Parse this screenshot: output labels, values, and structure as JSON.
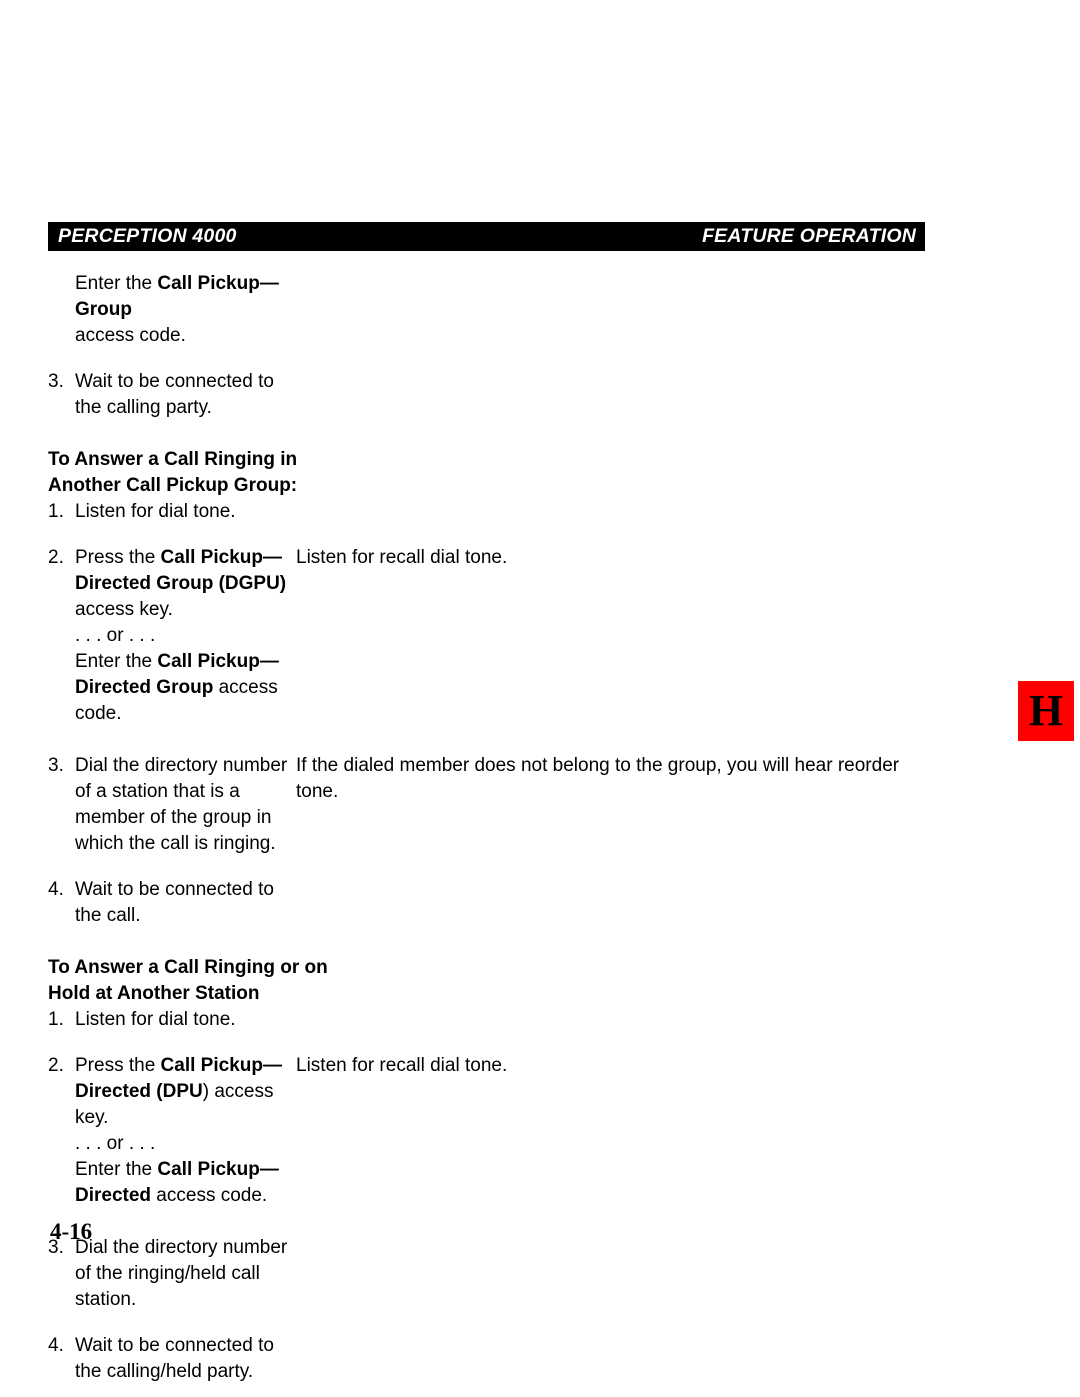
{
  "header": {
    "left_title": "PERCEPTION 4000",
    "right_title": "FEATURE OPERATION"
  },
  "thumb_tab": {
    "letter": "H",
    "background_color": "#fe0000",
    "text_color": "#000000"
  },
  "folio": {
    "page_number": "4-16"
  },
  "body": {
    "continuation": {
      "line1_prefix": "Enter the ",
      "line1_bold": "Call Pickup—Group",
      "line2": "access code."
    },
    "step_3_top": {
      "number": "3.",
      "text": "Wait to be connected to the calling party."
    },
    "section_1": {
      "heading_line1": "To Answer a Call Ringing in",
      "heading_line2": "Another Call Pickup Group:",
      "steps": [
        {
          "number": "1.",
          "text": "Listen for dial tone.",
          "note": ""
        },
        {
          "number": "2.",
          "press_prefix": "Press the ",
          "press_bold": "Call Pickup—Directed Group (DGPU)",
          "press_suffix": " access key.",
          "or_text": ". . . or . . .",
          "enter_prefix": "Enter the ",
          "enter_bold": "Call Pickup—Directed Group",
          "enter_suffix": " access code.",
          "note": "Listen for recall dial tone."
        },
        {
          "number": "3.",
          "text": "Dial the directory number of a station that is a member of the group in which the call is ringing.",
          "note": "If the dialed member does not belong to the group, you will hear reorder tone."
        },
        {
          "number": "4.",
          "text": "Wait to be connected to the call.",
          "note": ""
        }
      ]
    },
    "section_2": {
      "heading_line1": "To Answer a Call Ringing or on",
      "heading_line2": "Hold at Another Station",
      "steps": [
        {
          "number": "1.",
          "text": "Listen for dial tone.",
          "note": ""
        },
        {
          "number": "2.",
          "press_prefix": "Press the ",
          "press_bold": "Call Pickup—Directed (DPU",
          "press_paren_close": ")",
          "press_suffix": " access key.",
          "or_text": ". . . or . . .",
          "enter_prefix": "Enter the ",
          "enter_bold": "Call Pickup—Directed",
          "enter_suffix": " access code.",
          "note": "Listen for recall dial tone."
        },
        {
          "number": "3.",
          "text": "Dial the directory number of the ringing/held call station.",
          "note": ""
        },
        {
          "number": "4.",
          "text": "Wait to be connected to the calling/held party.",
          "note": ""
        }
      ]
    }
  }
}
